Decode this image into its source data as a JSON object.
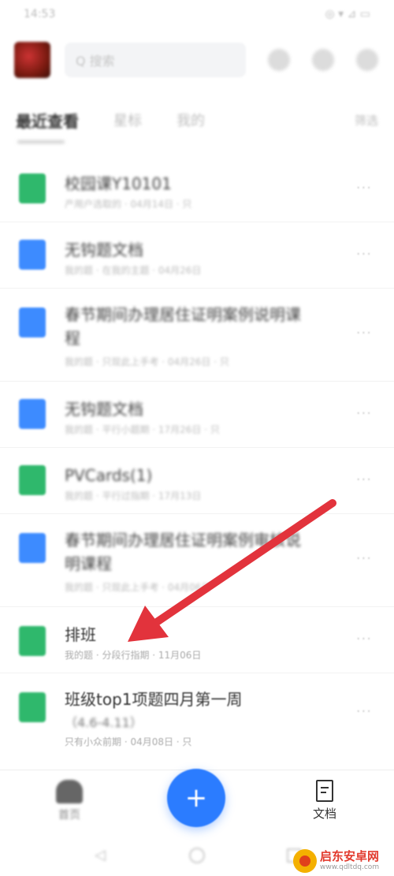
{
  "status_bar": {
    "left": "14:53",
    "right": "◎ ▾ ⊿ ▭"
  },
  "top_bar": {
    "search_placeholder": "Q 搜索"
  },
  "tabs": {
    "items": [
      "最近查看",
      "星标",
      "我的"
    ],
    "filter_label": "筛选"
  },
  "documents": [
    {
      "type": "sheet",
      "title": "校园课Y10101",
      "subtitle": "产用户选取的 · 04月14日 · 只"
    },
    {
      "type": "doc",
      "title": "无钩题文档",
      "subtitle": "我的题 · 在我的主题 · 04月26日"
    },
    {
      "type": "doc",
      "title": "春节期间办理居住证明案例说明课程",
      "subtitle": "我的题 · 只现此上手考 · 04月26日 · 只"
    },
    {
      "type": "doc",
      "title": "无钩题文档",
      "subtitle": "我的题 · 平行小题期 · 17月26日 · 只"
    },
    {
      "type": "sheet",
      "title": "PVCards(1)",
      "subtitle": "我的题 · 平行过指期 · 17月13日"
    },
    {
      "type": "doc",
      "title": "春节期间办理居住证明案例审核说明课程",
      "subtitle": "我的题 · 只现此上手考 · 04月06日"
    },
    {
      "type": "sheet",
      "title": "排班",
      "subtitle": "我的题 · 分段行指期 · 11月06日"
    },
    {
      "type": "sheet",
      "title": "班级top1项题四月第一周",
      "subtitle2": "（4.6-4.11）",
      "subtitle": "只有小众前期 · 04月08日 · 只"
    }
  ],
  "more_label": "···",
  "bottom_nav": {
    "home_label": "首页",
    "fab_label": "+",
    "docs_label": "文档"
  },
  "watermark": {
    "title": "启东安卓网",
    "url": "www.qdltdq.com"
  },
  "colors": {
    "sheet_icon": "#2fb86c",
    "doc_icon": "#3d8bff",
    "fab": "#2b7cff",
    "arrow": "#e2333c"
  }
}
